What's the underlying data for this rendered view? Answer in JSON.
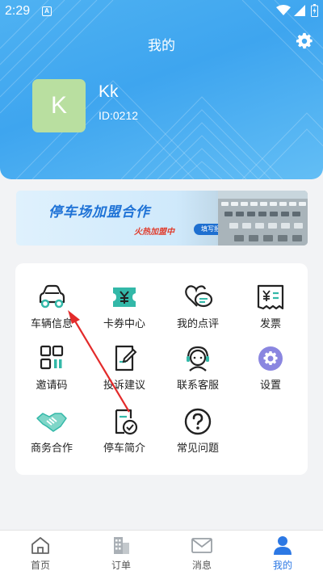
{
  "status_bar": {
    "time": "2:29",
    "notification_icon": "A"
  },
  "header": {
    "title": "我的"
  },
  "profile": {
    "avatar_letter": "K",
    "name": "Kk",
    "id": "ID:0212"
  },
  "banner": {
    "title": "停车场加盟合作",
    "subtitle": "火热加盟中",
    "button": "填写报名"
  },
  "menu": {
    "items": [
      {
        "label": "车辆信息",
        "icon": "car-icon"
      },
      {
        "label": "卡券中心",
        "icon": "coupon-icon"
      },
      {
        "label": "我的点评",
        "icon": "review-icon"
      },
      {
        "label": "发票",
        "icon": "invoice-icon"
      },
      {
        "label": "邀请码",
        "icon": "qrcode-icon"
      },
      {
        "label": "投诉建议",
        "icon": "complaint-icon"
      },
      {
        "label": "联系客服",
        "icon": "customer-service-icon"
      },
      {
        "label": "设置",
        "icon": "settings-icon"
      },
      {
        "label": "商务合作",
        "icon": "handshake-icon"
      },
      {
        "label": "停车简介",
        "icon": "parking-intro-icon"
      },
      {
        "label": "常见问题",
        "icon": "faq-icon"
      }
    ]
  },
  "tabbar": {
    "tabs": [
      {
        "label": "首页",
        "icon": "home-icon"
      },
      {
        "label": "订单",
        "icon": "order-icon"
      },
      {
        "label": "消息",
        "icon": "message-icon"
      },
      {
        "label": "我的",
        "icon": "profile-icon",
        "active": true
      }
    ]
  },
  "colors": {
    "header_blue": "#3ea5ef",
    "accent_blue": "#2c78e4",
    "teal": "#33b8a8",
    "avatar_green": "#b9dfa0"
  }
}
